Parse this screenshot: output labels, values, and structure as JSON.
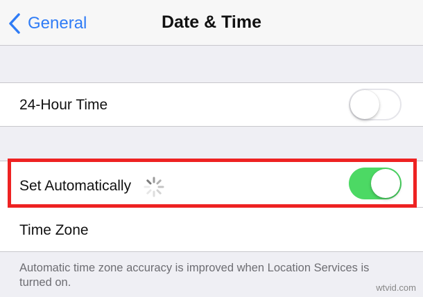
{
  "navbar": {
    "back_label": "General",
    "title": "Date & Time"
  },
  "settings": {
    "twenty_four_hour": {
      "label": "24-Hour Time",
      "enabled": false
    },
    "set_automatically": {
      "label": "Set Automatically",
      "enabled": true,
      "loading": true
    },
    "time_zone": {
      "label": "Time Zone"
    },
    "footer_note": "Automatic time zone accuracy is improved when Location Services is turned on."
  },
  "colors": {
    "accent": "#2f7cf6",
    "toggle_on": "#4cd964",
    "highlight": "#ee2222",
    "background": "#efeff4"
  },
  "watermark": "wtvid.com"
}
